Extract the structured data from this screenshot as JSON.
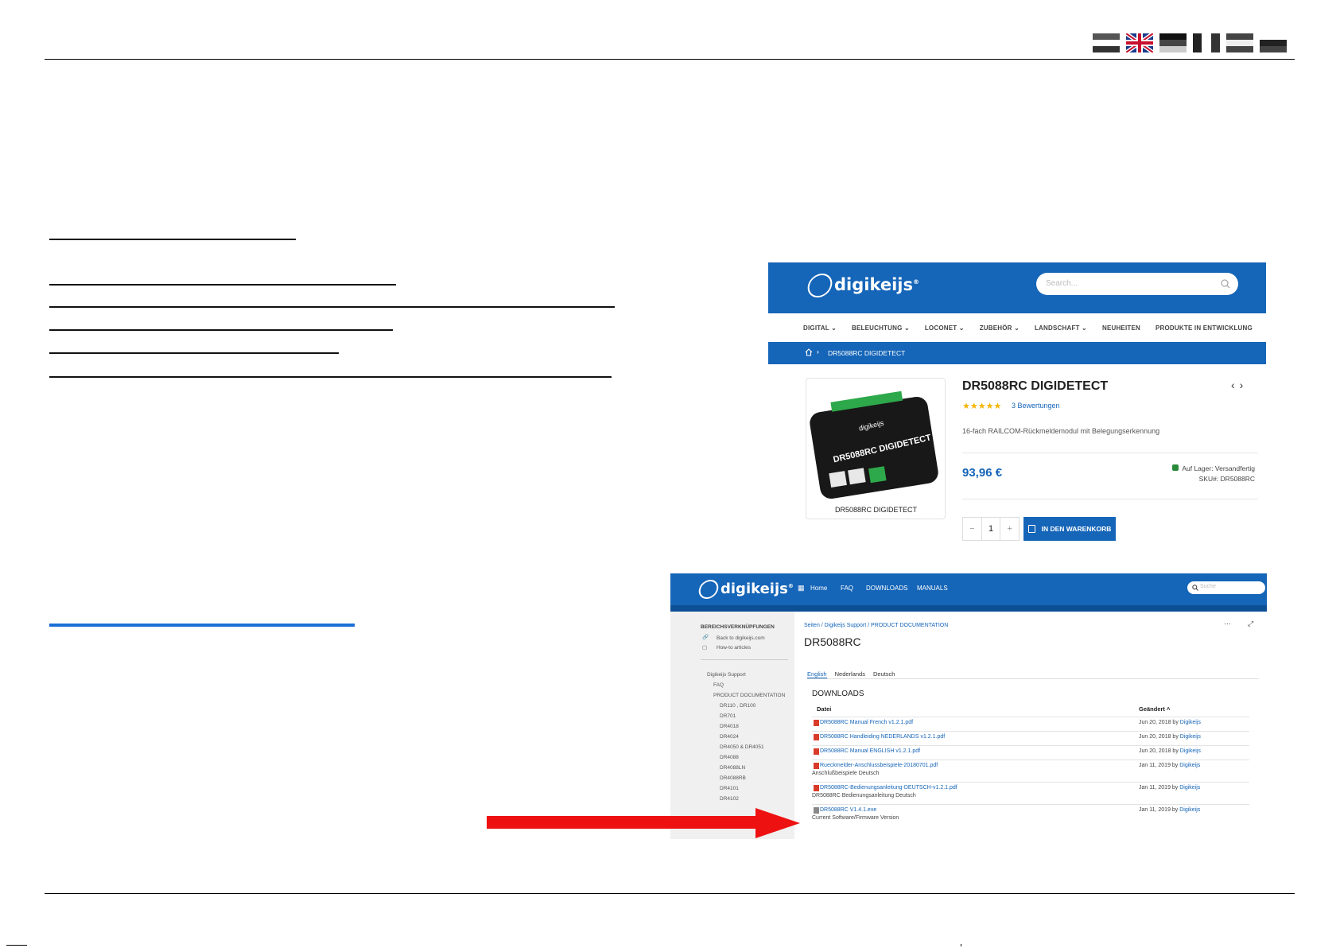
{
  "flags": [
    "flag-1",
    "flag-2",
    "flag-3",
    "flag-4",
    "flag-5",
    "flag-6"
  ],
  "shop": {
    "logo": "digikeijs",
    "search_placeholder": "Search...",
    "nav": [
      "DIGITAL ⌄",
      "BELEUCHTUNG ⌄",
      "LOCONET ⌄",
      "ZUBEHÖR ⌄",
      "LANDSCHAFT ⌄",
      "NEUHEITEN",
      "PRODUKTE IN ENTWICKLUNG"
    ],
    "breadcrumb": "DR5088RC DIGIDETECT",
    "image_caption": "DR5088RC DIGIDETECT",
    "board_text": "DR5088RC DIGIDETECT",
    "board_brand": "digikeijs",
    "title": "DR5088RC DIGIDETECT",
    "stars": "★★★★★",
    "reviews": "3 Bewertungen",
    "description": "16-fach RAILCOM-Rückmeldemodul mit Belegungserkennung",
    "price": "93,96 €",
    "stock": "Auf Lager: Versandfertig",
    "sku": "SKU#:  DR5088RC",
    "qty_minus": "−",
    "qty_value": "1",
    "qty_plus": "+",
    "cart_button": "IN DEN WARENKORB"
  },
  "conf": {
    "logo": "digikeijs",
    "nav": [
      "Home",
      "FAQ",
      "DOWNLOADS",
      "MANUALS"
    ],
    "search_placeholder": "Suche",
    "sidebar": {
      "heading": "BEREICHSVERKNÜPFUNGEN",
      "links": [
        "Back to digikeijs.com",
        "How-to articles"
      ],
      "tree": [
        "Digikeijs Support",
        "FAQ",
        "PRODUCT DOCUMENTATION",
        "DR110 , DR100",
        "DR701",
        "DR4018",
        "DR4024",
        "DR4050 & DR4051",
        "DR4088",
        "DR4088LN",
        "DR4088RB",
        "DR4101",
        "DR4102"
      ]
    },
    "breadcrumb": "Seiten  /  Digikeijs Support  /  PRODUCT DOCUMENTATION",
    "title": "DR5088RC",
    "tabs": [
      "English",
      "Nederlands",
      "Deutsch"
    ],
    "downloads_heading": "DOWNLOADS",
    "col_file": "Datei",
    "col_changed": "Geändert ˄",
    "files": [
      {
        "name": "DR5088RC Manual French v1.2.1.pdf",
        "sub": "",
        "date": "Jun 20, 2018 by ",
        "by": "Digikeijs"
      },
      {
        "name": "DR5088RC Handleiding NEDERLANDS v1.2.1.pdf",
        "sub": "",
        "date": "Jun 20, 2018 by ",
        "by": "Digikeijs"
      },
      {
        "name": "DR5088RC Manual ENGLISH v1.2.1.pdf",
        "sub": "",
        "date": "Jun 20, 2018 by ",
        "by": "Digikeijs"
      },
      {
        "name": "Rueckmelder-Anschlussbeispiele-20180701.pdf",
        "sub": "Anschlußbeispiele Deutsch",
        "date": "Jan 11, 2019 by ",
        "by": "Digikeijs"
      },
      {
        "name": "DR5088RC-Bedienungsanleitung-DEUTSCH-v1.2.1.pdf",
        "sub": "DR5088RC Bedienungsanleitung Deutsch",
        "date": "Jan 11, 2019 by ",
        "by": "Digikeijs"
      },
      {
        "name": "DR5088RC V1.4.1.exe",
        "sub": "Current Software/Firmware Version",
        "date": "Jan 11, 2019 by ",
        "by": "Digikeijs"
      }
    ]
  }
}
